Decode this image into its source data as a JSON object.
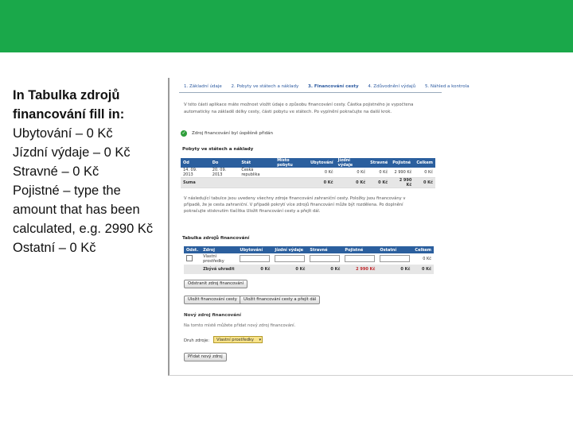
{
  "slide": {
    "accent_color": "#1aa84a",
    "instructions": {
      "title": "In Tabulka zdrojů financování fill in:",
      "lines": [
        "Ubytování – 0 Kč",
        "Jízdní výdaje – 0 Kč",
        "Stravné – 0 Kč",
        "Pojistné – type the amount that has been calculated, e.g. 2990 Kč",
        "Ostatní – 0 Kč"
      ]
    }
  },
  "app": {
    "steps": [
      "1. Základní údaje",
      "2. Pobyty ve státech a náklady",
      "3. Financování cesty",
      "4. Zdůvodnění výdajů",
      "5. Náhled a kontrola"
    ],
    "active_step": 2,
    "intro_text": "V této části aplikace máte možnost vložit údaje o způsobu financování cesty. Částka pojistného je vypočtena automaticky na základě délky cesty, části pobytu ve státech. Po vyplnění pokračujte na další krok.",
    "success_message": "Zdroj financování byl úspěšně přidán",
    "stays": {
      "title": "Pobyty ve státech a náklady",
      "headers": [
        "Od",
        "Do",
        "Stát",
        "Místo pobytu",
        "Ubytování",
        "Jízdní výdaje",
        "Stravné",
        "Pojistné",
        "Celkem"
      ],
      "rows": [
        [
          "14. 09. 2013",
          "20. 09. 2013",
          "Česká republika",
          "",
          "0 Kč",
          "0 Kč",
          "0 Kč",
          "2 990 Kč",
          "0 Kč"
        ]
      ],
      "sum": [
        "Suma",
        "",
        "",
        "",
        "0 Kč",
        "0 Kč",
        "0 Kč",
        "2 990 Kč",
        "0 Kč"
      ]
    },
    "note_text": "V následující tabulce jsou uvedeny všechny zdroje financování zahraniční cesty. Položky jsou financovány v případě, že je cesta zahraniční. V případě pokrytí více zdrojů financování může být rozdělena. Po doplnění pokračujte stisknutím tlačítka Uložit financování cesty a přejít dál.",
    "funding": {
      "title": "Tabulka zdrojů financování",
      "headers": [
        "Odst.",
        "Zdroj",
        "Ubytování",
        "Jízdní výdaje",
        "Stravné",
        "Pojistné",
        "Ostatní",
        "Celkem"
      ],
      "row_label": "Vlastní prostředky",
      "row_total": "0 Kč",
      "sum": [
        "",
        "Zbývá uhradit",
        "0 Kč",
        "0 Kč",
        "0 Kč",
        "2 990 Kč",
        "0 Kč",
        "0 Kč"
      ]
    },
    "buttons": {
      "remove_source": "Odstranit zdroj financování",
      "save": "Uložit financování cesty",
      "save_next": "Uložit financování cesty a přejít dál",
      "add_source": "Přidat nový zdroj"
    },
    "new_source": {
      "title": "Nový zdroj financování",
      "note": "Na tomto místě můžete přidat nový zdroj financování.",
      "label": "Druh zdroje:",
      "selected": "Vlastní prostředky"
    }
  }
}
